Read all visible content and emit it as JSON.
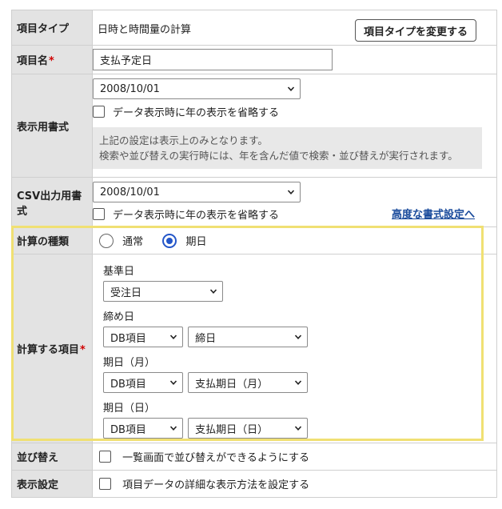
{
  "fields": {
    "item_type": {
      "label": "項目タイプ",
      "value": "日時と時間量の計算",
      "button": "項目タイプを変更する"
    },
    "item_name": {
      "label": "項目名",
      "required_mark": "*",
      "value": "支払予定日"
    },
    "display_format": {
      "label": "表示用書式",
      "format_value": "2008/10/01",
      "omit_year_label": "データ表示時に年の表示を省略する",
      "note_line1": "上記の設定は表示上のみとなります。",
      "note_line2": "検索や並び替えの実行時には、年を含んだ値で検索・並び替えが実行されます。"
    },
    "csv_format": {
      "label": "CSV出力用書式",
      "format_value": "2008/10/01",
      "omit_year_label": "データ表示時に年の表示を省略する",
      "advanced_link": "高度な書式設定へ"
    },
    "calc_type": {
      "label": "計算の種類",
      "option_normal": "通常",
      "option_due": "期日",
      "selected": "期日"
    },
    "calc_items": {
      "label": "計算する項目",
      "required_mark": "*",
      "base_date_label": "基準日",
      "base_date_value": "受注日",
      "closing_label": "締め日",
      "closing_source": "DB項目",
      "closing_field": "締日",
      "due_month_label": "期日（月）",
      "due_month_source": "DB項目",
      "due_month_field": "支払期日（月）",
      "due_day_label": "期日（日）",
      "due_day_source": "DB項目",
      "due_day_field": "支払期日（日）"
    },
    "sort": {
      "label": "並び替え",
      "checkbox_label": "一覧画面で並び替えができるようにする"
    },
    "display_settings": {
      "label": "表示設定",
      "checkbox_label": "項目データの詳細な表示方法を設定する"
    }
  },
  "colors": {
    "header_bg": "#e3e3e3",
    "required": "#d00000",
    "link": "#1a4b9c",
    "radio_selected": "#2456c9",
    "highlight_border": "#f0e073"
  }
}
